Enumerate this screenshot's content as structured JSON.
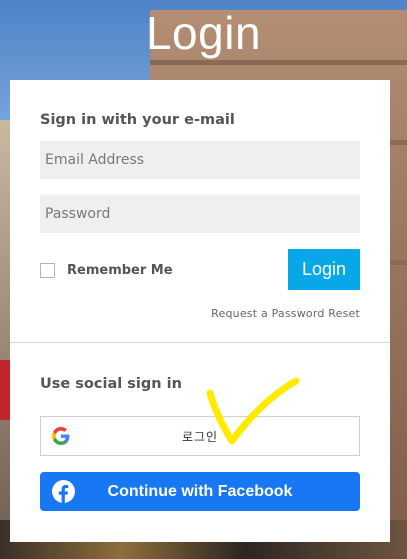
{
  "page": {
    "title": "Login"
  },
  "email_signin": {
    "heading": "Sign in with your e-mail",
    "email_placeholder": "Email Address",
    "password_placeholder": "Password",
    "remember_label": "Remember Me",
    "login_button": "Login",
    "reset_link": "Request a Password Reset"
  },
  "social": {
    "heading": "Use social sign in",
    "google_label": "로그인",
    "facebook_label": "Continue with Facebook"
  },
  "colors": {
    "login_button": "#08a8e8",
    "facebook": "#1877f2",
    "annotation": "#ffeb00"
  },
  "icons": {
    "google": "google-icon",
    "facebook": "facebook-icon"
  }
}
